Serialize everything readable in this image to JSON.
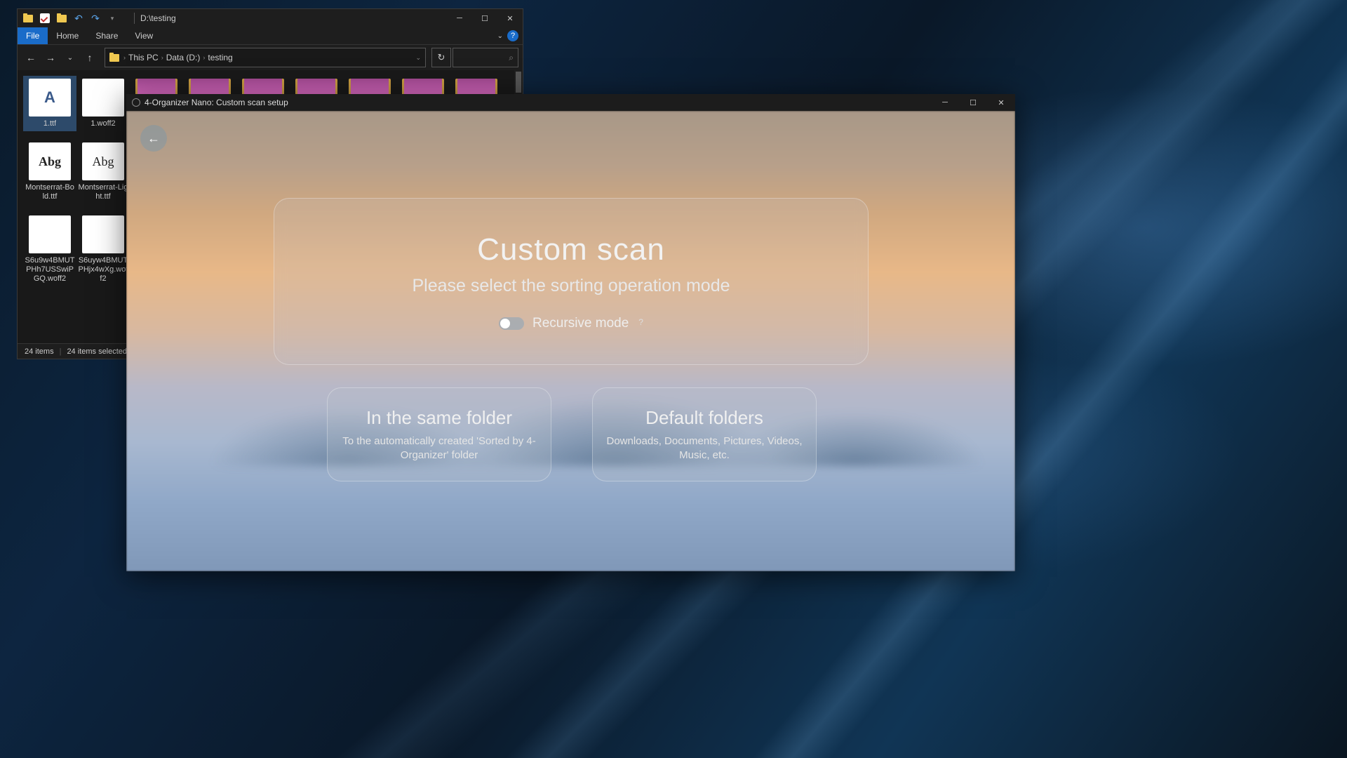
{
  "explorer": {
    "titlebar_path": "D:\\testing",
    "ribbon": {
      "file": "File",
      "tabs": [
        "Home",
        "Share",
        "View"
      ]
    },
    "breadcrumb": [
      "This PC",
      "Data (D:)",
      "testing"
    ],
    "files_row1": [
      "1.ttf",
      "1.woff2"
    ],
    "files_row2": [
      "Montserrat-Bold.ttf",
      "Montserrat-Light.ttf"
    ],
    "files_row3": [
      "S6u9w4BMUTPHh7USSwiPGQ.woff2",
      "S6uyw4BMUTPHjx4wXg.woff2"
    ],
    "status": {
      "count": "24 items",
      "selected": "24 items selected"
    }
  },
  "organizer": {
    "window_title": "4-Organizer Nano: Custom scan setup",
    "main": {
      "title": "Custom scan",
      "subtitle": "Please select the sorting operation mode",
      "toggle_label": "Recursive mode",
      "toggle_help": "?"
    },
    "option_same": {
      "title": "In the same folder",
      "desc": "To the automatically created 'Sorted by 4-Organizer' folder"
    },
    "option_default": {
      "title": "Default folders",
      "desc": "Downloads, Documents, Pictures, Videos, Music, etc."
    }
  }
}
